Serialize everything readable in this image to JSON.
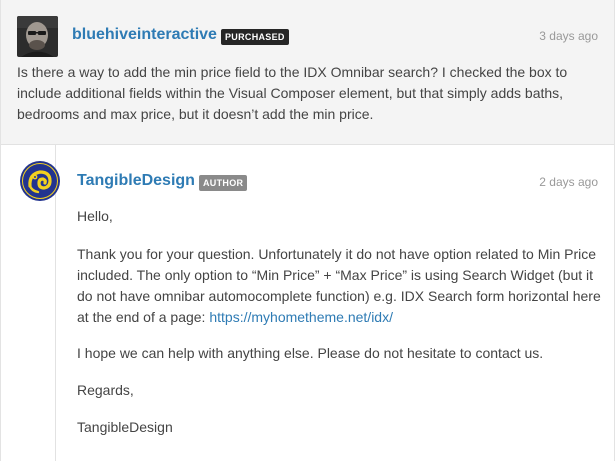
{
  "question": {
    "username": "bluehiveinteractive",
    "badge": "PURCHASED",
    "timestamp": "3 days ago",
    "body": "Is there a way to add the min price field to the IDX Omnibar search? I checked the box to include additional fields within the Visual Composer element, but that simply adds baths, bedrooms and max price, but it doesn’t add the min price."
  },
  "reply": {
    "username": "TangibleDesign",
    "badge": "AUTHOR",
    "timestamp": "2 days ago",
    "greeting": "Hello,",
    "paragraph1": "Thank you for your question. Unfortunately it do not have option related to Min Price included. The only option to “Min Price” + “Max Price” is using Search Widget (but it do not have omnibar automocomplete function) e.g. IDX Search form horizontal here at the end of a page: ",
    "link_text": "https://myhometheme.net/idx/",
    "paragraph2": "I hope we can help with anything else. Please do not hesitate to contact us.",
    "closing": "Regards,",
    "signature": "TangibleDesign"
  },
  "colors": {
    "username_link": "#2e7bb4",
    "purchased_badge": "#262626",
    "author_badge": "#8a8a8a",
    "question_bg": "#f4f4f4"
  }
}
